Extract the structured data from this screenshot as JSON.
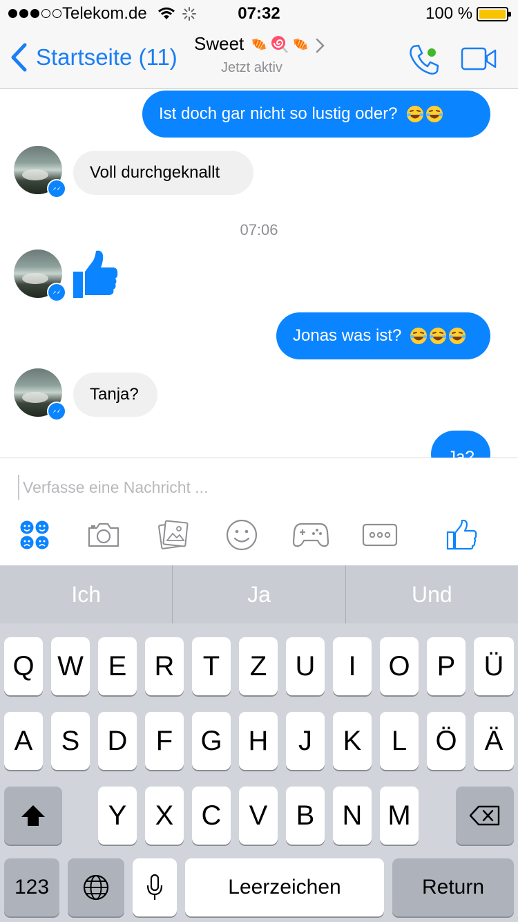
{
  "status_bar": {
    "carrier": "Telekom.de",
    "time": "07:32",
    "battery": "100 %",
    "battery_color": "#f9c300"
  },
  "nav": {
    "back_label": "Startseite (11)",
    "title": "Sweet",
    "title_icons": [
      "candy-icon",
      "lollipop-icon",
      "candy-icon"
    ],
    "subtitle": "Jetzt aktiv",
    "accent": "#1a7ef4"
  },
  "messages": {
    "out1": "Ist doch gar nicht so lustig oder?",
    "in1": "Voll durchgeknallt",
    "time1": "07:06",
    "out2": "Jonas was ist?",
    "in2": "Tanja?",
    "out3": "Ja?",
    "bubble_color": "#0b84ff"
  },
  "composer": {
    "placeholder": "Verfasse eine Nachricht ...",
    "tools": [
      "stickers-icon",
      "camera-icon",
      "gallery-icon",
      "emoji-icon",
      "game-icon",
      "more-icon",
      "like-icon"
    ]
  },
  "keyboard": {
    "suggestions": [
      "Ich",
      "Ja",
      "Und"
    ],
    "row1": [
      "Q",
      "W",
      "E",
      "R",
      "T",
      "Z",
      "U",
      "I",
      "O",
      "P",
      "Ü"
    ],
    "row2": [
      "A",
      "S",
      "D",
      "F",
      "G",
      "H",
      "J",
      "K",
      "L",
      "Ö",
      "Ä"
    ],
    "row3": [
      "Y",
      "X",
      "C",
      "V",
      "B",
      "N",
      "M"
    ],
    "numbers_label": "123",
    "space_label": "Leerzeichen",
    "return_label": "Return"
  }
}
